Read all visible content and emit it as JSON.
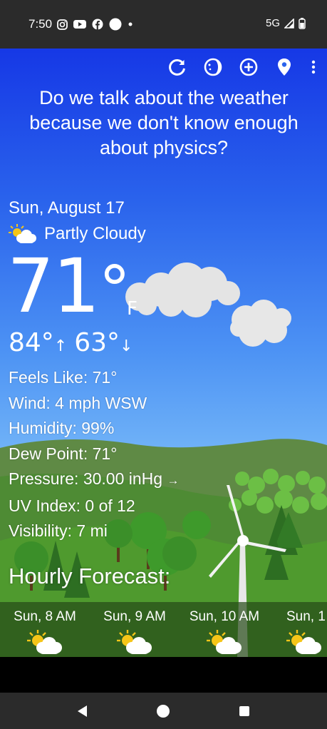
{
  "status_bar": {
    "time": "7:50",
    "network": "5G",
    "icons": [
      "instagram-icon",
      "youtube-icon",
      "facebook-icon",
      "circle-icon",
      "dot-icon",
      "signal-icon",
      "battery-icon"
    ]
  },
  "toolbar": {
    "icons": [
      "refresh-icon",
      "theme-icon",
      "add-location-icon",
      "location-pin-icon",
      "more-vert-icon"
    ]
  },
  "quote": "Do we talk about the weather because we don't know enough about physics?",
  "current": {
    "date": "Sun, August 17",
    "condition": "Partly Cloudy",
    "temperature": "71",
    "degree_symbol": "°",
    "unit": "F",
    "high": "84°",
    "high_arrow": "↑",
    "low": "63°",
    "low_arrow": "↓"
  },
  "details": {
    "feels_like": "Feels Like:  71°",
    "wind": "Wind:  4 mph WSW",
    "humidity": "Humidity:  99%",
    "dew_point": "Dew Point:  71°",
    "pressure": "Pressure:  30.00 inHg",
    "pressure_trend": "→",
    "uv_index": "UV Index:  0 of 12",
    "visibility": "Visibility:  7 mi"
  },
  "hourly": {
    "title": "Hourly Forecast:",
    "items": [
      {
        "label": "Sun, 8 AM",
        "icon": "partly-cloudy-icon"
      },
      {
        "label": "Sun, 9 AM",
        "icon": "partly-cloudy-icon"
      },
      {
        "label": "Sun, 10 AM",
        "icon": "partly-cloudy-icon"
      },
      {
        "label": "Sun, 1",
        "icon": "partly-cloudy-icon"
      }
    ]
  },
  "nav": {
    "icons": [
      "back-icon",
      "home-icon",
      "recents-icon"
    ]
  },
  "colors": {
    "sky_top": "#1638e6",
    "sky_bottom": "#9fd0fb",
    "grass": "#4f9a2e",
    "status_bar": "#2b2b2b"
  }
}
